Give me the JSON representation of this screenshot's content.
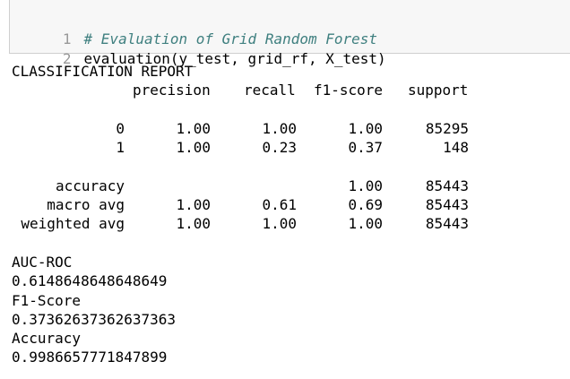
{
  "code_cell": {
    "lines": [
      {
        "number": "1",
        "text": "# Evaluation of Grid Random Forest"
      },
      {
        "number": "2",
        "text": "evaluation(y_test, grid_rf, X_test)"
      }
    ]
  },
  "report": {
    "title": "CLASSIFICATION REPORT",
    "headers": [
      "precision",
      "recall",
      "f1-score",
      "support"
    ],
    "rows": [
      {
        "label": "0",
        "precision": "1.00",
        "recall": "1.00",
        "f1": "1.00",
        "support": "85295"
      },
      {
        "label": "1",
        "precision": "1.00",
        "recall": "0.23",
        "f1": "0.37",
        "support": "148"
      }
    ],
    "summary": [
      {
        "label": "accuracy",
        "precision": "",
        "recall": "",
        "f1": "1.00",
        "support": "85443"
      },
      {
        "label": "macro avg",
        "precision": "1.00",
        "recall": "0.61",
        "f1": "0.69",
        "support": "85443"
      },
      {
        "label": "weighted avg",
        "precision": "1.00",
        "recall": "1.00",
        "f1": "1.00",
        "support": "85443"
      }
    ]
  },
  "metrics": [
    {
      "name": "AUC-ROC",
      "value": "0.6148648648648649"
    },
    {
      "name": "F1-Score",
      "value": "0.37362637362637363"
    },
    {
      "name": "Accuracy",
      "value": "0.9986657771847899"
    }
  ]
}
